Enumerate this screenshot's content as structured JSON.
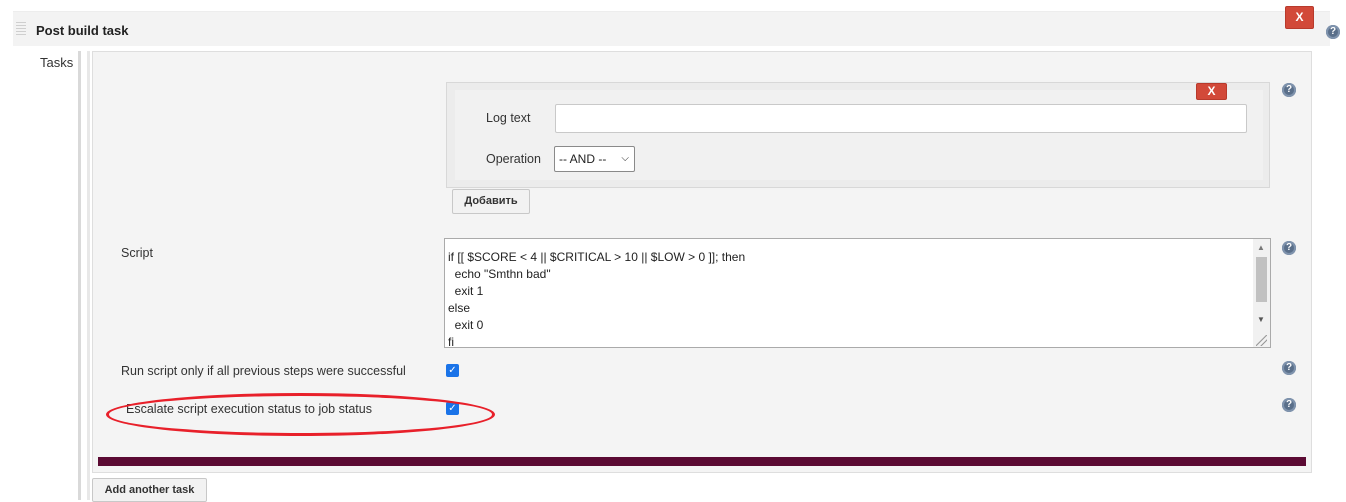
{
  "section": {
    "title": "Post build task",
    "delete_label": "X"
  },
  "tasks": {
    "label": "Tasks",
    "log_text_label": "Log text",
    "log_text_value": "",
    "operation_label": "Operation",
    "operation_selected": "-- AND --",
    "delete_label": "X",
    "add_label": "Добавить",
    "script_label": "Script",
    "script_lines": [
      "if [[ $SCORE < 4 || $CRITICAL > 10 || $LOW > 0 ]]; then",
      "  echo \"Smthn bad\"",
      "  exit 1",
      "else",
      "  exit 0",
      "fi"
    ],
    "run_only_success_label": "Run script only if all previous steps were successful",
    "run_only_success_checked": true,
    "escalate_label": "Escalate script execution status to job status",
    "escalate_checked": true,
    "add_another_label": "Add another task"
  },
  "help_icon_glyph": "?",
  "colors": {
    "delete_button": "#d24939",
    "checkbox": "#1a73e8",
    "highlight_ellipse": "#e8202a",
    "separator_bar": "#5b0a33"
  }
}
